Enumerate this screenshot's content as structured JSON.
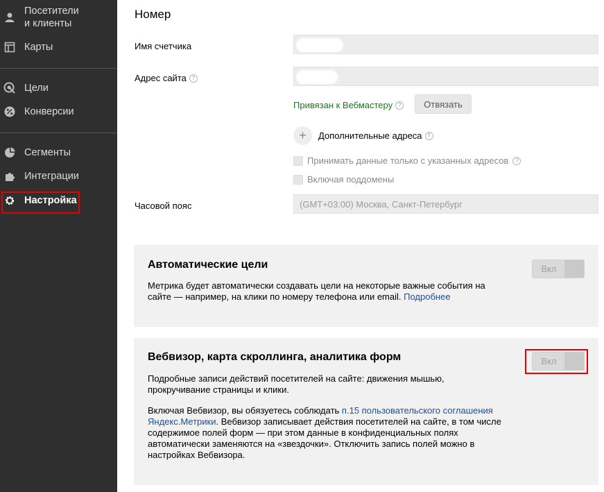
{
  "sidebar": {
    "items": [
      {
        "label": "Посетители\nи клиенты",
        "icon": "user-icon"
      },
      {
        "label": "Карты",
        "icon": "map-icon"
      },
      {
        "label": "Цели",
        "icon": "target-icon"
      },
      {
        "label": "Конверсии",
        "icon": "percent-icon"
      },
      {
        "label": "Сегменты",
        "icon": "pie-icon"
      },
      {
        "label": "Интеграции",
        "icon": "puzzle-icon"
      },
      {
        "label": "Настройка",
        "icon": "gear-icon"
      }
    ]
  },
  "main": {
    "title": "Номер",
    "counter_name_label": "Имя счетчика",
    "site_address_label": "Адрес сайта",
    "help_glyph": "?",
    "linked_text": "Привязан к Вебмастеру",
    "unlink_button": "Отвязать",
    "add_glyph": "+",
    "extra_addresses": "Дополнительные адреса",
    "accept_only_specified": "Принимать данные только с указанных адресов",
    "include_subdomains": "Включая поддомены",
    "timezone_label": "Часовой пояс",
    "timezone_value": "(GMT+03:00) Москва, Санкт-Петербург"
  },
  "auto_goals": {
    "title": "Автоматические цели",
    "text": "Метрика будет автоматически создавать цели на некоторые важные события на сайте — например, на клики по номеру телефона или email.",
    "link": "Подробнее",
    "toggle": "Вкл"
  },
  "webvisor": {
    "title": "Вебвизор, карта скроллинга, аналитика форм",
    "text1": "Подробные записи действий посетителей на сайте: движения мышью, прокручивание страницы и клики.",
    "text2_pre": "Включая Вебвизор, вы обязуетесь соблюдать ",
    "text2_link": "п.15 пользовательского соглашения Яндекс.Метрики",
    "text2_post": ". Вебвизор записывает действия посетителей на сайте, в том числе содержимое полей форм — при этом данные в конфиденциальных полях автоматически заменяются на «звездочки». Отключить запись полей можно в настройках Вебвизора.",
    "toggle": "Вкл"
  }
}
